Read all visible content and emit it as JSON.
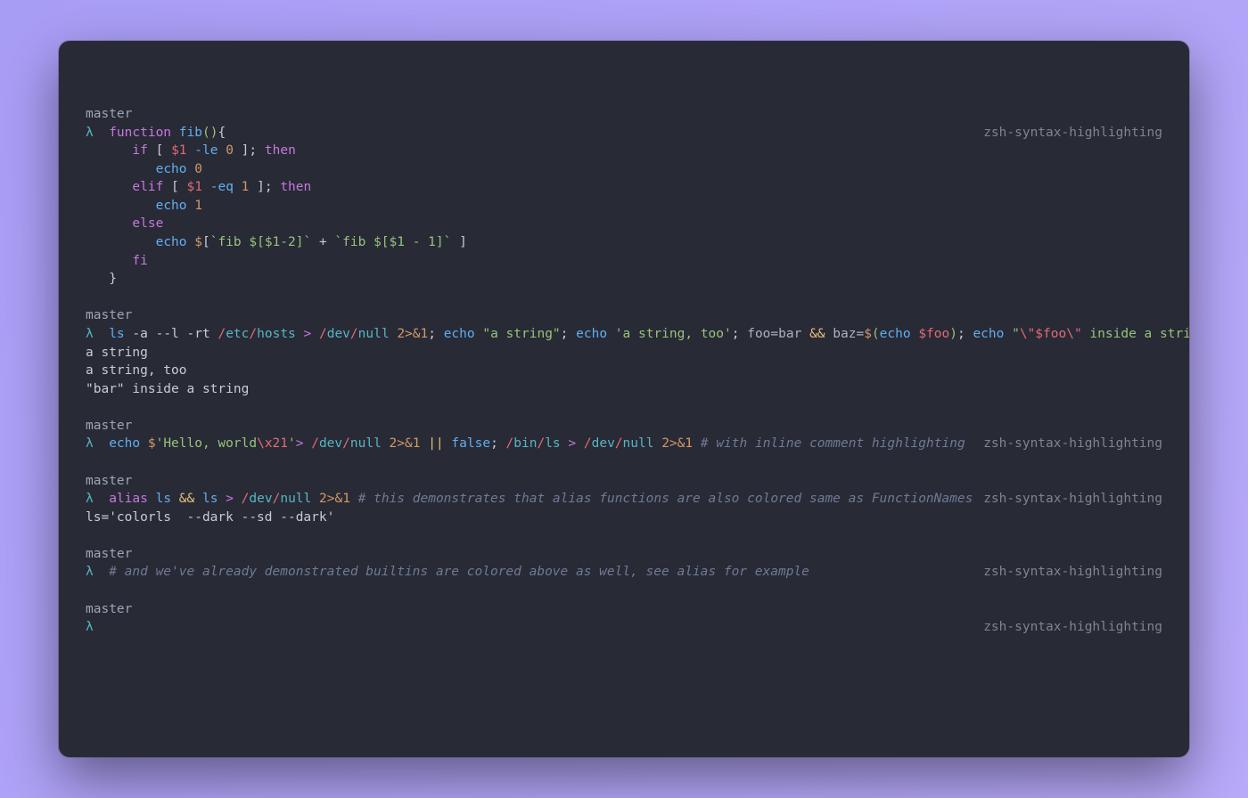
{
  "rightLabel": "zsh-syntax-highlighting",
  "branch": "master",
  "lambda": "λ",
  "blocks": [
    {
      "id": "b1",
      "right": true,
      "lines": [
        [
          {
            "t": "kw",
            "v": "function"
          },
          {
            "t": "op",
            "v": " "
          },
          {
            "t": "fn",
            "v": "fib"
          },
          {
            "t": "paren",
            "v": "()"
          },
          {
            "t": "op",
            "v": "{"
          }
        ],
        [
          {
            "t": "op",
            "v": "   "
          },
          {
            "t": "kw",
            "v": "if"
          },
          {
            "t": "op",
            "v": " [ "
          },
          {
            "t": "var",
            "v": "$1"
          },
          {
            "t": "op",
            "v": " "
          },
          {
            "t": "fn",
            "v": "-le"
          },
          {
            "t": "op",
            "v": " "
          },
          {
            "t": "num",
            "v": "0"
          },
          {
            "t": "op",
            "v": " ]; "
          },
          {
            "t": "kw",
            "v": "then"
          }
        ],
        [
          {
            "t": "op",
            "v": "      "
          },
          {
            "t": "fn",
            "v": "echo"
          },
          {
            "t": "op",
            "v": " "
          },
          {
            "t": "num",
            "v": "0"
          }
        ],
        [
          {
            "t": "op",
            "v": "   "
          },
          {
            "t": "kw",
            "v": "elif"
          },
          {
            "t": "op",
            "v": " [ "
          },
          {
            "t": "var",
            "v": "$1"
          },
          {
            "t": "op",
            "v": " "
          },
          {
            "t": "fn",
            "v": "-eq"
          },
          {
            "t": "op",
            "v": " "
          },
          {
            "t": "num",
            "v": "1"
          },
          {
            "t": "op",
            "v": " ]; "
          },
          {
            "t": "kw",
            "v": "then"
          }
        ],
        [
          {
            "t": "op",
            "v": "      "
          },
          {
            "t": "fn",
            "v": "echo"
          },
          {
            "t": "op",
            "v": " "
          },
          {
            "t": "num",
            "v": "1"
          }
        ],
        [
          {
            "t": "op",
            "v": "   "
          },
          {
            "t": "kw",
            "v": "else"
          }
        ],
        [
          {
            "t": "op",
            "v": "      "
          },
          {
            "t": "fn",
            "v": "echo"
          },
          {
            "t": "op",
            "v": " "
          },
          {
            "t": "num",
            "v": "$"
          },
          {
            "t": "op",
            "v": "["
          },
          {
            "t": "str",
            "v": "`fib $[$1-2]`"
          },
          {
            "t": "op",
            "v": " + "
          },
          {
            "t": "str",
            "v": "`fib $[$1 - 1]`"
          },
          {
            "t": "op",
            "v": " ]"
          }
        ],
        [
          {
            "t": "op",
            "v": "   "
          },
          {
            "t": "kw",
            "v": "fi"
          }
        ],
        [
          {
            "t": "op",
            "v": "}"
          }
        ]
      ],
      "output": []
    },
    {
      "id": "b2",
      "right": false,
      "lines": [
        [
          {
            "t": "fn",
            "v": "ls"
          },
          {
            "t": "op",
            "v": " "
          },
          {
            "t": "flag",
            "v": "-a --l -rt"
          },
          {
            "t": "op",
            "v": " "
          },
          {
            "t": "path",
            "v": "/"
          },
          {
            "t": "pathseg",
            "v": "etc"
          },
          {
            "t": "path",
            "v": "/"
          },
          {
            "t": "pathseg",
            "v": "hosts"
          },
          {
            "t": "op",
            "v": " "
          },
          {
            "t": "redir",
            "v": ">"
          },
          {
            "t": "op",
            "v": " "
          },
          {
            "t": "path",
            "v": "/"
          },
          {
            "t": "pathseg",
            "v": "dev"
          },
          {
            "t": "path",
            "v": "/"
          },
          {
            "t": "pathseg",
            "v": "null"
          },
          {
            "t": "op",
            "v": " "
          },
          {
            "t": "num",
            "v": "2>&1"
          },
          {
            "t": "op",
            "v": "; "
          },
          {
            "t": "fn",
            "v": "echo"
          },
          {
            "t": "op",
            "v": " "
          },
          {
            "t": "str",
            "v": "\"a string\""
          },
          {
            "t": "op",
            "v": "; "
          },
          {
            "t": "fn",
            "v": "echo"
          },
          {
            "t": "op",
            "v": " "
          },
          {
            "t": "str",
            "v": "'a string, too'"
          },
          {
            "t": "op",
            "v": "; "
          },
          {
            "t": "cmd",
            "v": "foo=bar"
          },
          {
            "t": "op",
            "v": " "
          },
          {
            "t": "amp",
            "v": "&&"
          },
          {
            "t": "op",
            "v": " "
          },
          {
            "t": "cmd",
            "v": "baz="
          },
          {
            "t": "num",
            "v": "$"
          },
          {
            "t": "paren",
            "v": "("
          },
          {
            "t": "fn",
            "v": "echo"
          },
          {
            "t": "op",
            "v": " "
          },
          {
            "t": "var",
            "v": "$foo"
          },
          {
            "t": "paren",
            "v": ")"
          },
          {
            "t": "op",
            "v": "; "
          },
          {
            "t": "fn",
            "v": "echo"
          },
          {
            "t": "op",
            "v": " "
          },
          {
            "t": "str",
            "v": "\""
          },
          {
            "t": "esc",
            "v": "\\\""
          },
          {
            "t": "var",
            "v": "$foo"
          },
          {
            "t": "esc",
            "v": "\\\""
          },
          {
            "t": "str",
            "v": " inside a string\""
          }
        ]
      ],
      "output": [
        "a string",
        "a string, too",
        "\"bar\" inside a string"
      ]
    },
    {
      "id": "b3",
      "right": true,
      "lines": [
        [
          {
            "t": "fn",
            "v": "echo"
          },
          {
            "t": "op",
            "v": " "
          },
          {
            "t": "num",
            "v": "$"
          },
          {
            "t": "str",
            "v": "'Hello, world"
          },
          {
            "t": "esc",
            "v": "\\x21"
          },
          {
            "t": "str",
            "v": "'"
          },
          {
            "t": "redir",
            "v": ">"
          },
          {
            "t": "op",
            "v": " "
          },
          {
            "t": "path",
            "v": "/"
          },
          {
            "t": "pathseg",
            "v": "dev"
          },
          {
            "t": "path",
            "v": "/"
          },
          {
            "t": "pathseg",
            "v": "null"
          },
          {
            "t": "op",
            "v": " "
          },
          {
            "t": "num",
            "v": "2>&1"
          },
          {
            "t": "op",
            "v": " "
          },
          {
            "t": "pipe",
            "v": "||"
          },
          {
            "t": "op",
            "v": " "
          },
          {
            "t": "fn",
            "v": "false"
          },
          {
            "t": "op",
            "v": "; "
          },
          {
            "t": "path",
            "v": "/"
          },
          {
            "t": "pathseg",
            "v": "bin"
          },
          {
            "t": "path",
            "v": "/"
          },
          {
            "t": "pathseg",
            "v": "ls"
          },
          {
            "t": "op",
            "v": " "
          },
          {
            "t": "redir",
            "v": ">"
          },
          {
            "t": "op",
            "v": " "
          },
          {
            "t": "path",
            "v": "/"
          },
          {
            "t": "pathseg",
            "v": "dev"
          },
          {
            "t": "path",
            "v": "/"
          },
          {
            "t": "pathseg",
            "v": "null"
          },
          {
            "t": "op",
            "v": " "
          },
          {
            "t": "num",
            "v": "2>&1"
          },
          {
            "t": "op",
            "v": " "
          },
          {
            "t": "cmt",
            "v": "# with inline comment highlighting"
          }
        ]
      ],
      "output": []
    },
    {
      "id": "b4",
      "right": true,
      "lines": [
        [
          {
            "t": "kw",
            "v": "alias"
          },
          {
            "t": "op",
            "v": " "
          },
          {
            "t": "fn",
            "v": "ls"
          },
          {
            "t": "op",
            "v": " "
          },
          {
            "t": "amp",
            "v": "&&"
          },
          {
            "t": "op",
            "v": " "
          },
          {
            "t": "fn",
            "v": "ls"
          },
          {
            "t": "op",
            "v": " "
          },
          {
            "t": "redir",
            "v": ">"
          },
          {
            "t": "op",
            "v": " "
          },
          {
            "t": "path",
            "v": "/"
          },
          {
            "t": "pathseg",
            "v": "dev"
          },
          {
            "t": "path",
            "v": "/"
          },
          {
            "t": "pathseg",
            "v": "null"
          },
          {
            "t": "op",
            "v": " "
          },
          {
            "t": "num",
            "v": "2>&1"
          },
          {
            "t": "op",
            "v": " "
          },
          {
            "t": "cmt",
            "v": "# this demonstrates that alias functions are also colored same as FunctionNames"
          }
        ]
      ],
      "output": [
        "ls='colorls  --dark --sd --dark'"
      ]
    },
    {
      "id": "b5",
      "right": true,
      "lines": [
        [
          {
            "t": "cmt",
            "v": "# and we've already demonstrated builtins are colored above as well, see alias for example"
          }
        ]
      ],
      "output": []
    },
    {
      "id": "b6",
      "right": true,
      "lines": [
        [
          {
            "t": "op",
            "v": ""
          }
        ]
      ],
      "output": []
    }
  ]
}
